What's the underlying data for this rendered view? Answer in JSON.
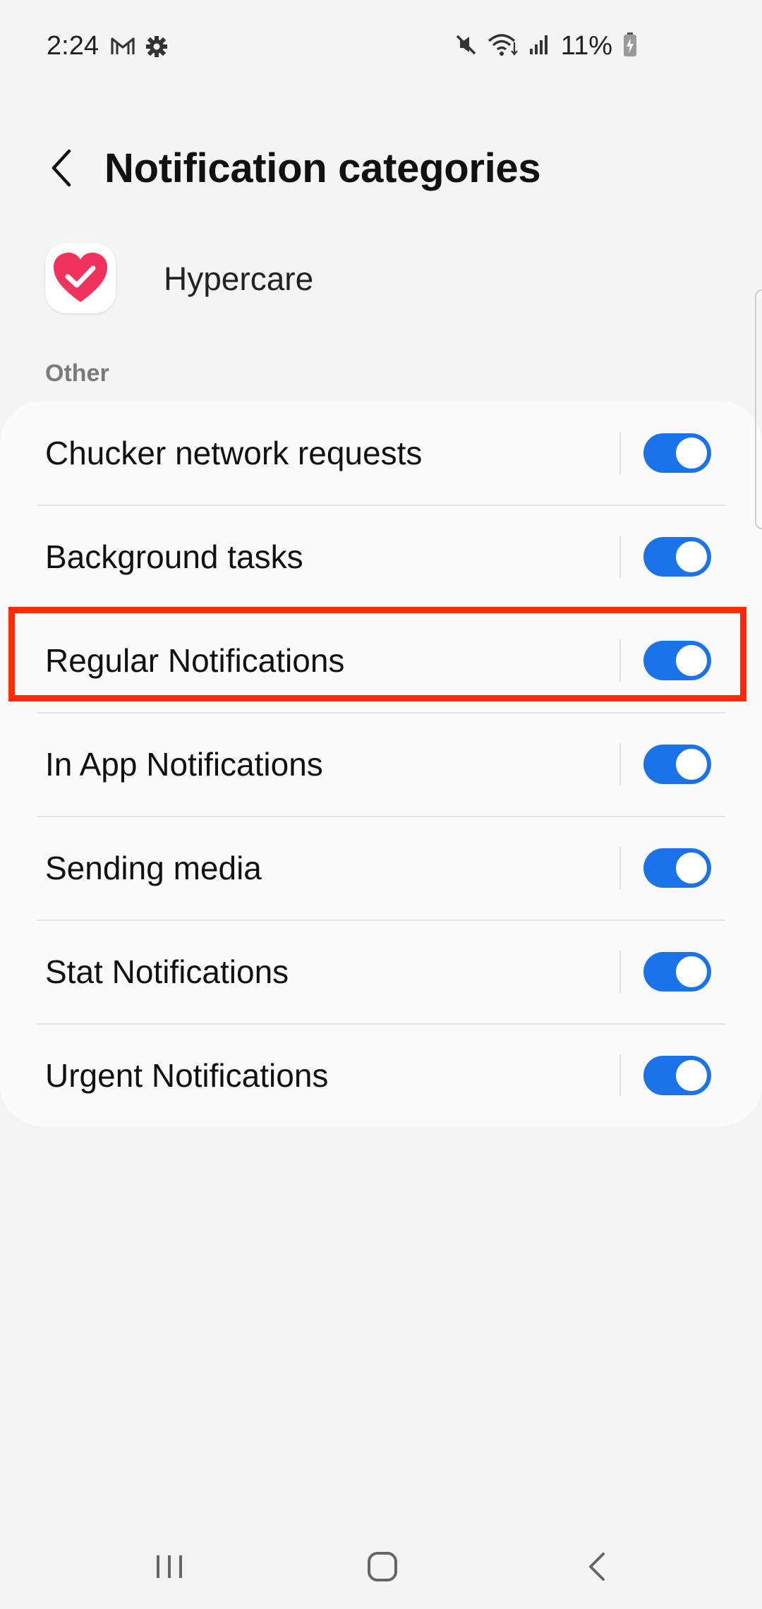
{
  "status_bar": {
    "time": "2:24",
    "battery_text": "11%",
    "icons": [
      "gmail-icon",
      "settings-gear-icon",
      "mute-icon",
      "wifi-icon",
      "signal-icon",
      "battery-charging-icon"
    ]
  },
  "header": {
    "title": "Notification categories",
    "back_icon": "chevron-left-icon"
  },
  "app": {
    "name": "Hypercare",
    "icon": "heart-check-icon",
    "icon_color": "#f0335d"
  },
  "section": {
    "label": "Other"
  },
  "categories": [
    {
      "label": "Chucker network requests",
      "enabled": true
    },
    {
      "label": "Background tasks",
      "enabled": true
    },
    {
      "label": "Regular Notifications",
      "enabled": true
    },
    {
      "label": "In App Notifications",
      "enabled": true
    },
    {
      "label": "Sending media",
      "enabled": true
    },
    {
      "label": "Stat Notifications",
      "enabled": true
    },
    {
      "label": "Urgent Notifications",
      "enabled": true
    }
  ],
  "highlight": {
    "target": "Regular Notifications",
    "color": "#ff2a0a"
  },
  "colors": {
    "toggle_on": "#1a73e8",
    "background": "#f4f4f4",
    "card": "#fbfbfb"
  },
  "nav_bar": {
    "buttons": [
      "recent-apps-icon",
      "home-icon",
      "back-icon"
    ]
  }
}
